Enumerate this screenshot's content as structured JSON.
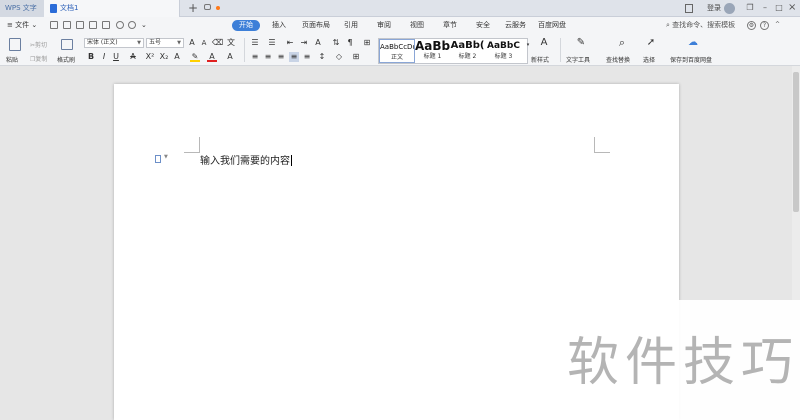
{
  "titlebar": {
    "app_name": "WPS 文字",
    "doc_tab": "文档1",
    "new_tab": "+",
    "login": "登录",
    "restore": "❐",
    "minimize": "–",
    "maximize": "□",
    "close": "×"
  },
  "menubar": {
    "file": "≡ 文件 ⌄",
    "tabs": [
      "开始",
      "插入",
      "页面布局",
      "引用",
      "审阅",
      "视图",
      "章节",
      "安全",
      "云服务",
      "百度网盘"
    ],
    "active_tab": "开始",
    "search": "查找命令、搜索模板",
    "help": "?",
    "settings": "⚙",
    "collapse": "^"
  },
  "ribbon": {
    "paste": "粘贴",
    "cut": "剪切",
    "copy": "复制",
    "format_painter": "格式刷",
    "font_name": "宋体 (正文)",
    "font_size": "五号",
    "styles": [
      {
        "sample": "AaBbCcDd",
        "name": "正文"
      },
      {
        "sample": "AaBb",
        "name": "标题 1"
      },
      {
        "sample": "AaBb(",
        "name": "标题 2"
      },
      {
        "sample": "AaBbC",
        "name": "标题 3"
      }
    ],
    "new_style": "新样式",
    "text_tools": "文字工具",
    "find_replace": "查找替换",
    "select": "选择",
    "save_baidu": "保存到百度网盘"
  },
  "document": {
    "content": "输入我们需要的内容"
  },
  "watermark": "软件技巧",
  "colors": {
    "accent": "#3d7fd8",
    "font_color": "#e02020",
    "highlight": "#ffd000"
  }
}
